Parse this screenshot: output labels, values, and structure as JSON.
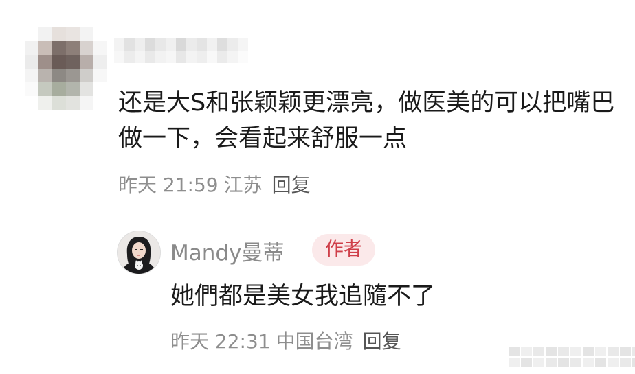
{
  "comment": {
    "text": "还是大S和张颖颖更漂亮，做医美的可以把嘴巴做一下，会看起来舒服一点",
    "time": "昨天 21:59",
    "location": "江苏",
    "reply_label": "回复",
    "avatar_icon": "pixelated-avatar-icon",
    "username_obscured": true
  },
  "reply": {
    "author_name": "Mandy曼蒂",
    "author_badge": "作者",
    "text": "她們都是美女我追隨不了",
    "time": "昨天 22:31",
    "location": "中国台湾",
    "reply_label": "回复",
    "avatar_icon": "user-avatar-icon"
  },
  "colors": {
    "badge_bg": "#fbe9ea",
    "badge_text": "#cf3f4a",
    "meta_text": "#8e8e8e",
    "body_text": "#1a1a1a"
  }
}
